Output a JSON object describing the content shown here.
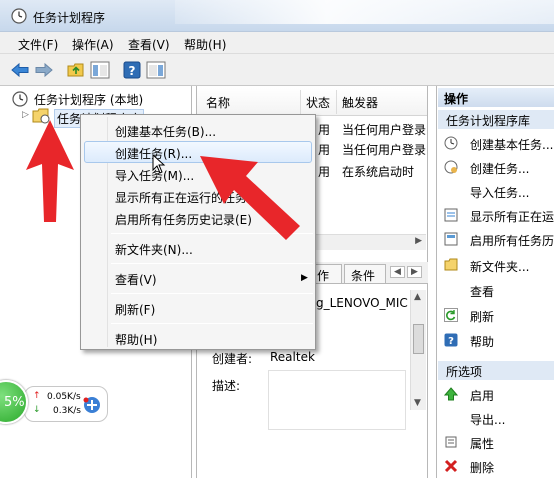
{
  "window": {
    "title": "任务计划程序"
  },
  "menu": [
    "文件(F)",
    "操作(A)",
    "查看(V)",
    "帮助(H)"
  ],
  "tree": {
    "root": "任务计划程序 (本地)",
    "child": "任务计划程序库"
  },
  "table": {
    "headers": [
      "名称",
      "状态",
      "触发器"
    ],
    "rows": [
      [
        "用",
        "当任何用户登录"
      ],
      [
        "用",
        "当任何用户登录"
      ],
      [
        "用",
        "在系统启动时"
      ]
    ]
  },
  "detail": {
    "tabs": [
      "作",
      "条件"
    ],
    "name_fragment": "g_LENOVO_MIC",
    "author_label": "创建者:",
    "author_value": "Realtek",
    "desc_label": "描述:"
  },
  "actions": {
    "header": "操作",
    "section1": "任务计划程序库",
    "items1": [
      "创建基本任务...",
      "创建任务...",
      "导入任务...",
      "显示所有正在运",
      "启用所有任务历",
      "新文件夹...",
      "查看",
      "刷新",
      "帮助"
    ],
    "section2": "所选项",
    "items2": [
      "启用",
      "导出...",
      "属性",
      "删除"
    ]
  },
  "context_menu": {
    "items": [
      "创建基本任务(B)...",
      "创建任务(R)...",
      "导入任务(M)...",
      "显示所有正在运行的任务(U)",
      "启用所有任务历史记录(E)",
      "新文件夹(N)...",
      "查看(V)",
      "刷新(F)",
      "帮助(H)"
    ]
  },
  "net_widget": {
    "percent": "5%",
    "upload": "0.05K/s",
    "download": "0.3K/s"
  },
  "colors": {
    "arrow": "#e8262a",
    "accent": "#2f6db5",
    "highlight": "#dcebfc"
  }
}
